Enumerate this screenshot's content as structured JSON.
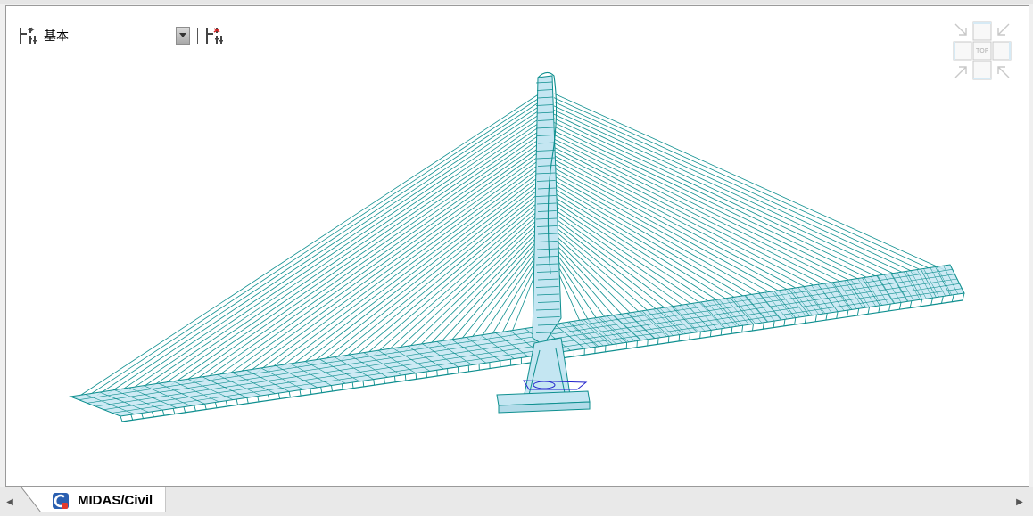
{
  "toolbar": {
    "view_preset_value": "基本"
  },
  "view_cube": {
    "face_label": "TOP"
  },
  "tabs": [
    {
      "label": "MIDAS/Civil"
    }
  ],
  "colors": {
    "wireframe": "#0e8f8f",
    "deck_fill": "#c4e6f2",
    "selection": "#2222cc",
    "background": "#ffffff"
  }
}
